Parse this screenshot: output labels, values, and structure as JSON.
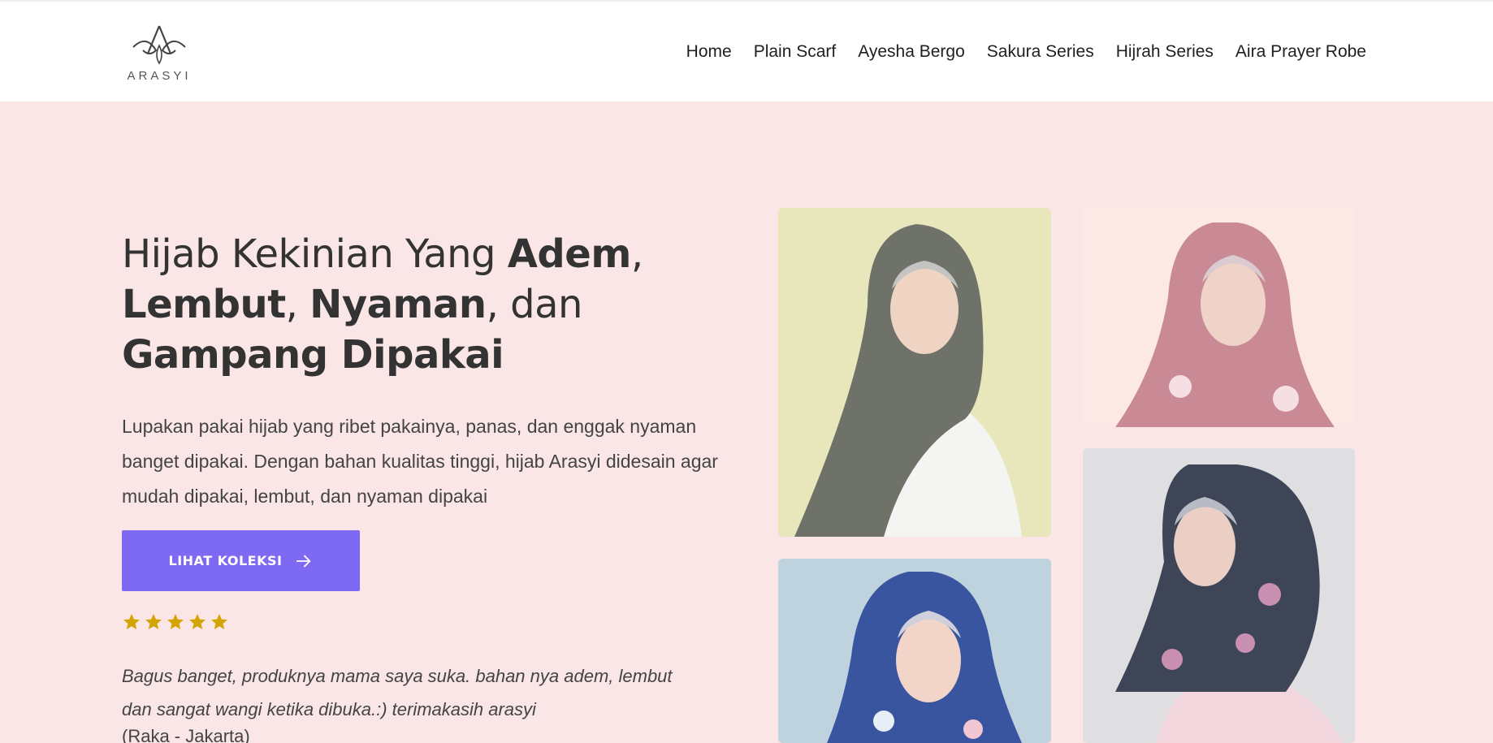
{
  "brand": {
    "name": "ARASYI",
    "logo_icon": "arasyi-logo-icon"
  },
  "nav": {
    "items": [
      {
        "label": "Home"
      },
      {
        "label": "Plain Scarf"
      },
      {
        "label": "Ayesha Bergo"
      },
      {
        "label": "Sakura Series"
      },
      {
        "label": "Hijrah Series"
      },
      {
        "label": "Aira Prayer Robe"
      }
    ]
  },
  "hero": {
    "headline": {
      "part1": "Hijab Kekinian Yang ",
      "bold1": "Adem",
      "part2": ",",
      "bold2": "Lembut",
      "part3": ", ",
      "bold3": "Nyaman",
      "part4": ", dan",
      "bold4": "Gampang Dipakai"
    },
    "description": "Lupakan pakai hijab yang ribet pakainya, panas, dan enggak nyaman banget dipakai. Dengan bahan kualitas tinggi, hijab Arasyi didesain agar mudah dipakai, lembut, dan nyaman dipakai",
    "cta_label": "LIHAT KOLEKSI",
    "cta_icon": "arrow-right-icon"
  },
  "testimonial": {
    "rating": 5,
    "rating_max": 5,
    "text": "Bagus banget, produknya mama saya suka. bahan nya adem, lembut dan sangat wangi ketika dibuka.:) terimakasih arasyi",
    "author": "(Raka - Jakarta)"
  },
  "colors": {
    "page_background": "#fae6e6",
    "accent": "#7e69f2",
    "star": "#d4a405",
    "text": "#333333"
  },
  "products": [
    {
      "icon": "olive-hijab-model-image",
      "background": "#e8e6bb",
      "scarf_color": "#6f7268"
    },
    {
      "icon": "pink-floral-hijab-model-image",
      "background": "#fce8e4",
      "scarf_color": "#c98a95"
    },
    {
      "icon": "blue-floral-hijab-model-image",
      "background": "#bfd3de",
      "scarf_color": "#3a55a0"
    },
    {
      "icon": "navy-sakura-hijab-model-image",
      "background": "#dfdfe2",
      "scarf_color": "#3d4556"
    }
  ]
}
